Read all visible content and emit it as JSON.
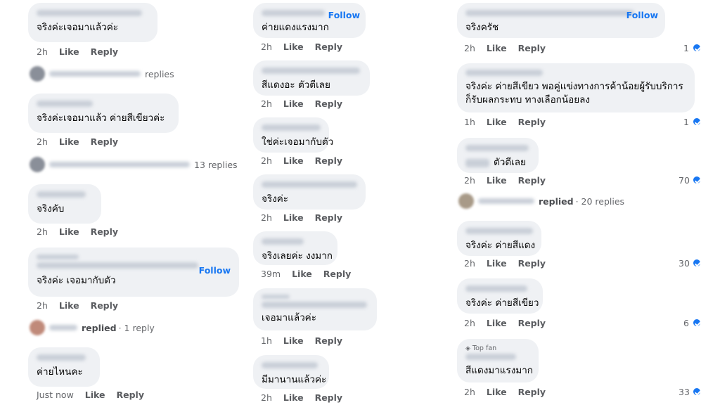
{
  "actions": {
    "like": "Like",
    "reply": "Reply",
    "follow": "Follow",
    "top_fan": "Top fan"
  },
  "col1": {
    "c1": {
      "text": "จริงค่ะเจอมาแล้วค่ะ",
      "time": "2h"
    },
    "r1": {
      "text": "replies"
    },
    "c2": {
      "text": "จริงค่ะเจอมาแล้ว ค่ายสีเขียวค่ะ",
      "time": "2h"
    },
    "r2": {
      "text": "13 replies"
    },
    "c3": {
      "text": "จริงคับ",
      "time": "2h"
    },
    "c4": {
      "text": "จริงค่ะ เจอมากับตัว",
      "time": "2h"
    },
    "r4": {
      "replied": "replied",
      "count": "· 1 reply"
    },
    "c5": {
      "text": "ค่ายไหนคะ",
      "time": "Just now"
    }
  },
  "col2": {
    "c1": {
      "text": "ค่ายแดงแรงมาก",
      "time": "2h"
    },
    "c2": {
      "text": "สีแดงอะ ตัวตีเลย",
      "time": "2h"
    },
    "c3": {
      "text": "ใช่ค่ะเจอมากับตัว",
      "time": "2h"
    },
    "c4": {
      "text": "จริงค่ะ",
      "time": "2h"
    },
    "c5": {
      "text": "จริงเลยค่ะ งงมาก",
      "time": "39m"
    },
    "c6": {
      "text": "เจอมาแล้วค่ะ",
      "time": "1h"
    },
    "c7": {
      "text": "มีมานานแล้วค่ะ",
      "time": "2h"
    }
  },
  "col3": {
    "c1": {
      "text": "จริงครัช",
      "time": "2h",
      "reactions": "1"
    },
    "c2": {
      "text": "จริงค่ะ ค่ายสีเขียว พอคู่แข่งทางการค้าน้อยผู้รับบริการก็รับผลกระทบ ทางเลือกน้อยลง",
      "time": "1h",
      "reactions": "1"
    },
    "c3": {
      "text": "ตัวตีเลย",
      "time": "2h",
      "reactions": "70"
    },
    "r3": {
      "replied": "replied",
      "count": "· 20 replies"
    },
    "c4": {
      "text": "จริงค่ะ ค่ายสีแดง",
      "time": "2h",
      "reactions": "30"
    },
    "c5": {
      "text": "จริงค่ะ ค่ายสีเขียว",
      "time": "2h",
      "reactions": "6"
    },
    "c6": {
      "text": "สีแดงมาแรงมาก",
      "time": "2h",
      "reactions": "33"
    }
  }
}
